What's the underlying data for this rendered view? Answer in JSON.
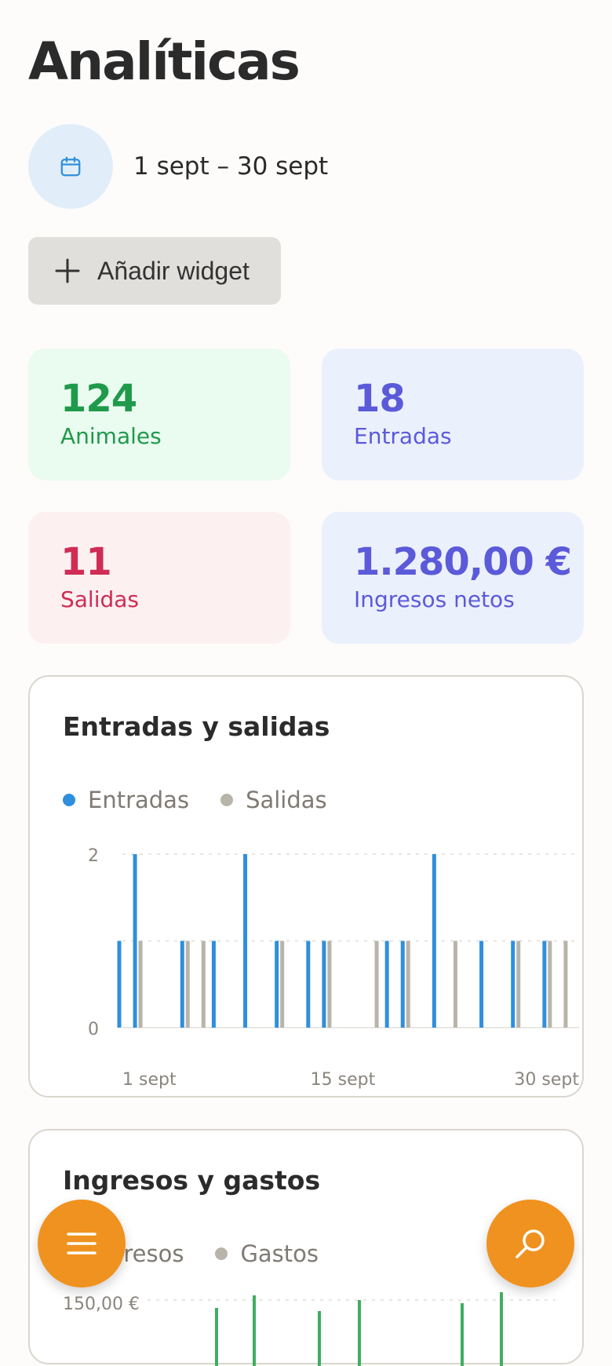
{
  "header": {
    "title": "Analíticas"
  },
  "date_range": {
    "label": "1 sept – 30 sept",
    "icon": "calendar-icon"
  },
  "add_widget": {
    "label": "Añadir widget",
    "icon": "plus-icon"
  },
  "stats": [
    {
      "value": "124",
      "label": "Animales",
      "bg": "#eafbf0",
      "color": "#1f9a4b"
    },
    {
      "value": "18",
      "label": "Entradas",
      "bg": "#ebf0fd",
      "color": "#5b5ad9"
    },
    {
      "value": "11",
      "label": "Salidas",
      "bg": "#fdf0f0",
      "color": "#cf2d55"
    },
    {
      "value": "1.280,00 €",
      "label": "Ingresos netos",
      "bg": "#ebf0fd",
      "color": "#5b5ad9"
    }
  ],
  "chart_inout": {
    "title": "Entradas y salidas",
    "legend": [
      {
        "name": "Entradas",
        "color": "#2f8fdc"
      },
      {
        "name": "Salidas",
        "color": "#b9b4aa"
      }
    ],
    "y_ticks": [
      "2",
      "0"
    ],
    "x_ticks": [
      "1 sept",
      "15 sept",
      "30 sept"
    ]
  },
  "chart_money": {
    "title": "Ingresos y gastos",
    "legend": [
      {
        "name": "Ingresos",
        "color": "#3fae62"
      },
      {
        "name": "Gastos",
        "color": "#b9b4aa"
      }
    ],
    "y_ticks": [
      "150,00 €"
    ]
  },
  "chart_data": [
    {
      "type": "bar",
      "title": "Entradas y salidas",
      "x": [
        1,
        2,
        3,
        4,
        5,
        6,
        7,
        8,
        9,
        10,
        11,
        12,
        13,
        14,
        15,
        16,
        17,
        18,
        19,
        20,
        21,
        22,
        23,
        24,
        25,
        26,
        27,
        28,
        29,
        30
      ],
      "x_tick_labels": [
        "1 sept",
        "15 sept",
        "30 sept"
      ],
      "ylim": [
        0,
        2
      ],
      "y_ticks": [
        0,
        2
      ],
      "grid": true,
      "legend": "top-left",
      "series": [
        {
          "name": "Entradas",
          "color": "#2f8fdc",
          "values": [
            1,
            2,
            0,
            0,
            1,
            0,
            1,
            0,
            2,
            0,
            1,
            0,
            1,
            1,
            0,
            0,
            0,
            1,
            1,
            0,
            2,
            0,
            0,
            1,
            0,
            1,
            0,
            1,
            0,
            0
          ]
        },
        {
          "name": "Salidas",
          "color": "#b9b4aa",
          "values": [
            0,
            1,
            0,
            0,
            1,
            1,
            0,
            0,
            0,
            0,
            1,
            0,
            0,
            1,
            0,
            0,
            1,
            0,
            1,
            0,
            0,
            1,
            0,
            0,
            0,
            1,
            0,
            1,
            1,
            0
          ]
        }
      ]
    },
    {
      "type": "bar",
      "title": "Ingresos y gastos",
      "legend": "top-left",
      "y_ticks": [
        "150,00 €"
      ],
      "series": [
        {
          "name": "Ingresos",
          "color": "#3fae62",
          "values": []
        },
        {
          "name": "Gastos",
          "color": "#b9b4aa",
          "values": []
        }
      ]
    }
  ],
  "nav": {
    "menu_icon": "menu-icon",
    "search_icon": "search-icon",
    "accent": "#f0921f"
  }
}
